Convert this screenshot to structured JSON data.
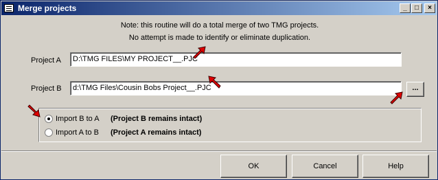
{
  "window": {
    "title": "Merge projects"
  },
  "titlebar": {
    "minimize": "_",
    "maximize": "□",
    "close": "×"
  },
  "note": {
    "line1": "Note: this routine will do a total merge of two TMG projects.",
    "line2": "No attempt is made to identify or eliminate duplication."
  },
  "project_a": {
    "label": "Project A",
    "value": "D:\\TMG FILES\\MY PROJECT__.PJC"
  },
  "project_b": {
    "label": "Project B",
    "value": "d:\\TMG Files\\Cousin Bobs Project__.PJC",
    "browse_label": "..."
  },
  "options": [
    {
      "label": "Import B to A",
      "note": "(Project B remains intact)",
      "selected": true
    },
    {
      "label": "Import A to B",
      "note": "(Project A remains intact)",
      "selected": false
    }
  ],
  "buttons": {
    "ok": "OK",
    "cancel": "Cancel",
    "help": "Help"
  },
  "colors": {
    "arrow": "#e00000",
    "titlebar": "#0a246a"
  }
}
